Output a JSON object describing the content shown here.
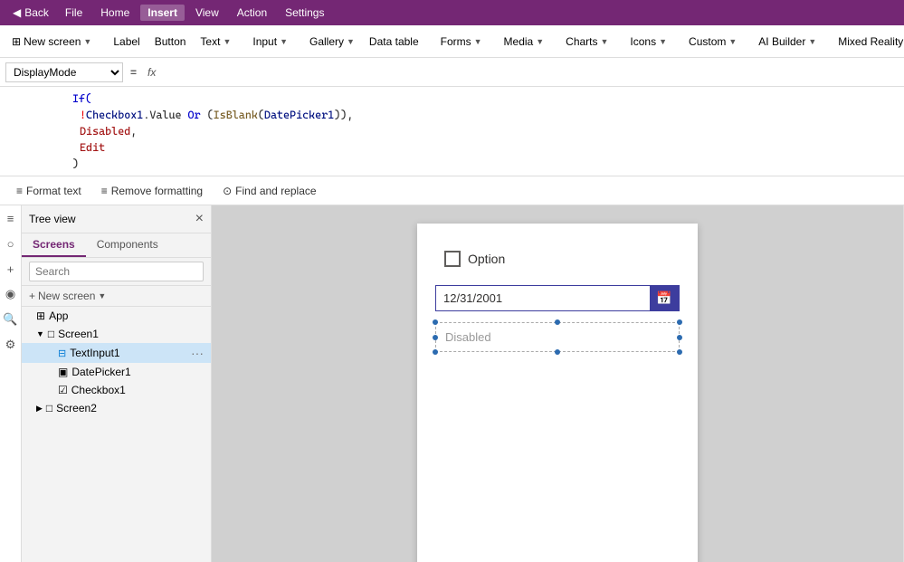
{
  "topbar": {
    "back_label": "Back",
    "file_label": "File",
    "home_label": "Home",
    "insert_label": "Insert",
    "view_label": "View",
    "action_label": "Action",
    "settings_label": "Settings",
    "active_tab": "Insert"
  },
  "toolbar": {
    "new_screen_label": "New screen",
    "label_label": "Label",
    "button_label": "Button",
    "text_label": "Text",
    "input_label": "Input",
    "gallery_label": "Gallery",
    "data_table_label": "Data table",
    "forms_label": "Forms",
    "media_label": "Media",
    "charts_label": "Charts",
    "icons_label": "Icons",
    "custom_label": "Custom",
    "ai_builder_label": "AI Builder",
    "mixed_reality_label": "Mixed Reality"
  },
  "formula_bar": {
    "property": "DisplayMode",
    "eq": "=",
    "fx": "fx",
    "formula_text": "If(ICheckbox1.Value Or (IsBlank(DatePicker1)),Disabled,Edit)"
  },
  "formula_display": {
    "line1": "If(",
    "line2": "!Checkbox1.Value Or (IsBlank(DatePicker1)),",
    "line3": "Disabled,",
    "line4": "Edit",
    "line5": ")"
  },
  "format_bar": {
    "format_text_label": "Format text",
    "remove_formatting_label": "Remove formatting",
    "find_replace_label": "Find and replace"
  },
  "tree_view": {
    "title": "Tree view",
    "close_icon": "×",
    "tabs": [
      {
        "label": "Screens",
        "active": true
      },
      {
        "label": "Components",
        "active": false
      }
    ],
    "search_placeholder": "Search",
    "new_screen_label": "New screen",
    "app_label": "App",
    "items": [
      {
        "label": "Screen1",
        "indent": 1,
        "type": "screen",
        "icon": "□"
      },
      {
        "label": "TextInput1",
        "indent": 2,
        "type": "textinput",
        "icon": "⊟",
        "selected": true,
        "more": true
      },
      {
        "label": "DatePicker1",
        "indent": 2,
        "type": "datepicker",
        "icon": "▣"
      },
      {
        "label": "Checkbox1",
        "indent": 2,
        "type": "checkbox",
        "icon": "☑"
      },
      {
        "label": "Screen2",
        "indent": 1,
        "type": "screen",
        "icon": "□"
      }
    ]
  },
  "canvas": {
    "checkbox_label": "Option",
    "datepicker_value": "12/31/2001",
    "textinput_placeholder": "Disabled"
  },
  "icons": {
    "back": "◀",
    "expand": "▼",
    "search": "🔍",
    "plus": "+",
    "new_screen": "⊞",
    "app": "⊞",
    "calendar": "📅",
    "format_text": "≡",
    "remove_format": "≡",
    "find_replace": "⊙",
    "tree_icons": [
      "≡",
      "○",
      "✏",
      "◉",
      "🔍"
    ]
  }
}
